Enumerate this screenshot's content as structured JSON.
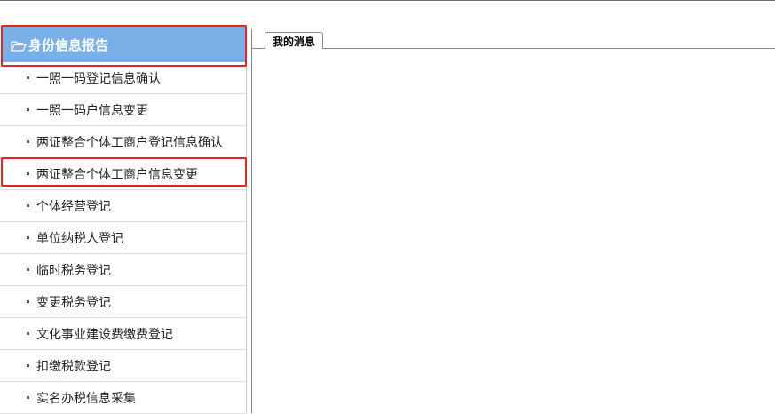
{
  "sidebar": {
    "header": "身份信息报告",
    "items": [
      {
        "label": "一照一码登记信息确认"
      },
      {
        "label": "一照一码户信息变更"
      },
      {
        "label": "两证整合个体工商户登记信息确认"
      },
      {
        "label": "两证整合个体工商户信息变更"
      },
      {
        "label": "个体经营登记"
      },
      {
        "label": "单位纳税人登记"
      },
      {
        "label": "临时税务登记"
      },
      {
        "label": "变更税务登记"
      },
      {
        "label": "文化事业建设费缴费登记"
      },
      {
        "label": "扣缴税款登记"
      },
      {
        "label": "实名办税信息采集"
      }
    ]
  },
  "content": {
    "tabs": [
      {
        "label": "我的消息"
      }
    ]
  },
  "colors": {
    "header_bg": "#7ab0e8",
    "highlight": "#e8241b"
  },
  "icons": {
    "header": "folder-open-icon"
  }
}
